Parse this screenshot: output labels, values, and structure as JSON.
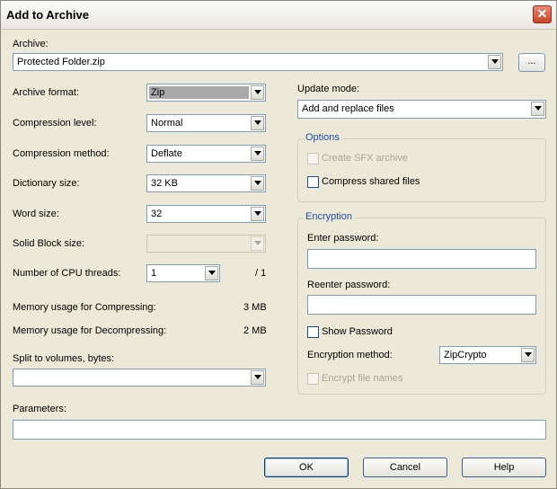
{
  "window": {
    "title": "Add to Archive",
    "close_glyph": "✕"
  },
  "archive": {
    "label": "Archive:",
    "value": "Protected Folder.zip",
    "browse_label": "..."
  },
  "format": {
    "label": "Archive format:",
    "value": "Zip"
  },
  "compression_level": {
    "label": "Compression level:",
    "value": "Normal"
  },
  "compression_method": {
    "label": "Compression method:",
    "value": "Deflate"
  },
  "dictionary": {
    "label": "Dictionary size:",
    "value": "32 KB"
  },
  "word": {
    "label": "Word size:",
    "value": "32"
  },
  "solid": {
    "label": "Solid Block size:",
    "value": ""
  },
  "threads": {
    "label": "Number of CPU threads:",
    "value": "1",
    "max": "/ 1"
  },
  "memory": {
    "compress_label": "Memory usage for Compressing:",
    "compress_value": "3 MB",
    "decompress_label": "Memory usage for Decompressing:",
    "decompress_value": "2 MB"
  },
  "split": {
    "label": "Split to volumes, bytes:",
    "value": ""
  },
  "parameters": {
    "label": "Parameters:",
    "value": ""
  },
  "update": {
    "label": "Update mode:",
    "value": "Add and replace files"
  },
  "options": {
    "title": "Options",
    "sfx_label": "Create SFX archive",
    "shared_label": "Compress shared files"
  },
  "encryption": {
    "title": "Encryption",
    "enter_label": "Enter password:",
    "reenter_label": "Reenter password:",
    "show_label": "Show Password",
    "method_label": "Encryption method:",
    "method_value": "ZipCrypto",
    "encrypt_names_label": "Encrypt file names"
  },
  "buttons": {
    "ok": "OK",
    "cancel": "Cancel",
    "help": "Help"
  }
}
